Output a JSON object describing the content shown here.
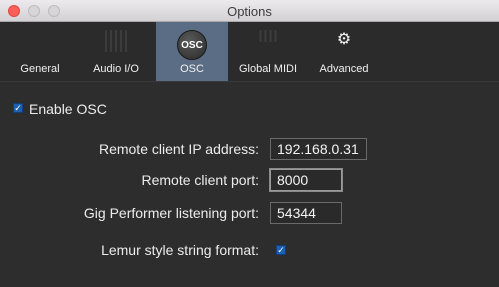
{
  "window": {
    "title": "Options"
  },
  "tabs": [
    {
      "label": "General"
    },
    {
      "label": "Audio I/O"
    },
    {
      "label": "OSC",
      "icon_text": "OSC"
    },
    {
      "label": "Global MIDI"
    },
    {
      "label": "Advanced"
    }
  ],
  "selected_tab": "OSC",
  "osc": {
    "enable_label": "Enable OSC",
    "enable_checked": true,
    "fields": [
      {
        "label": "Remote client IP address:",
        "value": "192.168.0.31"
      },
      {
        "label": "Remote client port:",
        "value": "8000"
      },
      {
        "label": "Gig Performer listening port:",
        "value": "54344"
      }
    ],
    "lemur_label": "Lemur style string format:",
    "lemur_checked": true
  },
  "colors": {
    "selected_tab": "#5b6d84",
    "checkbox": "#1f5fb0",
    "background": "#2d2d2d"
  }
}
